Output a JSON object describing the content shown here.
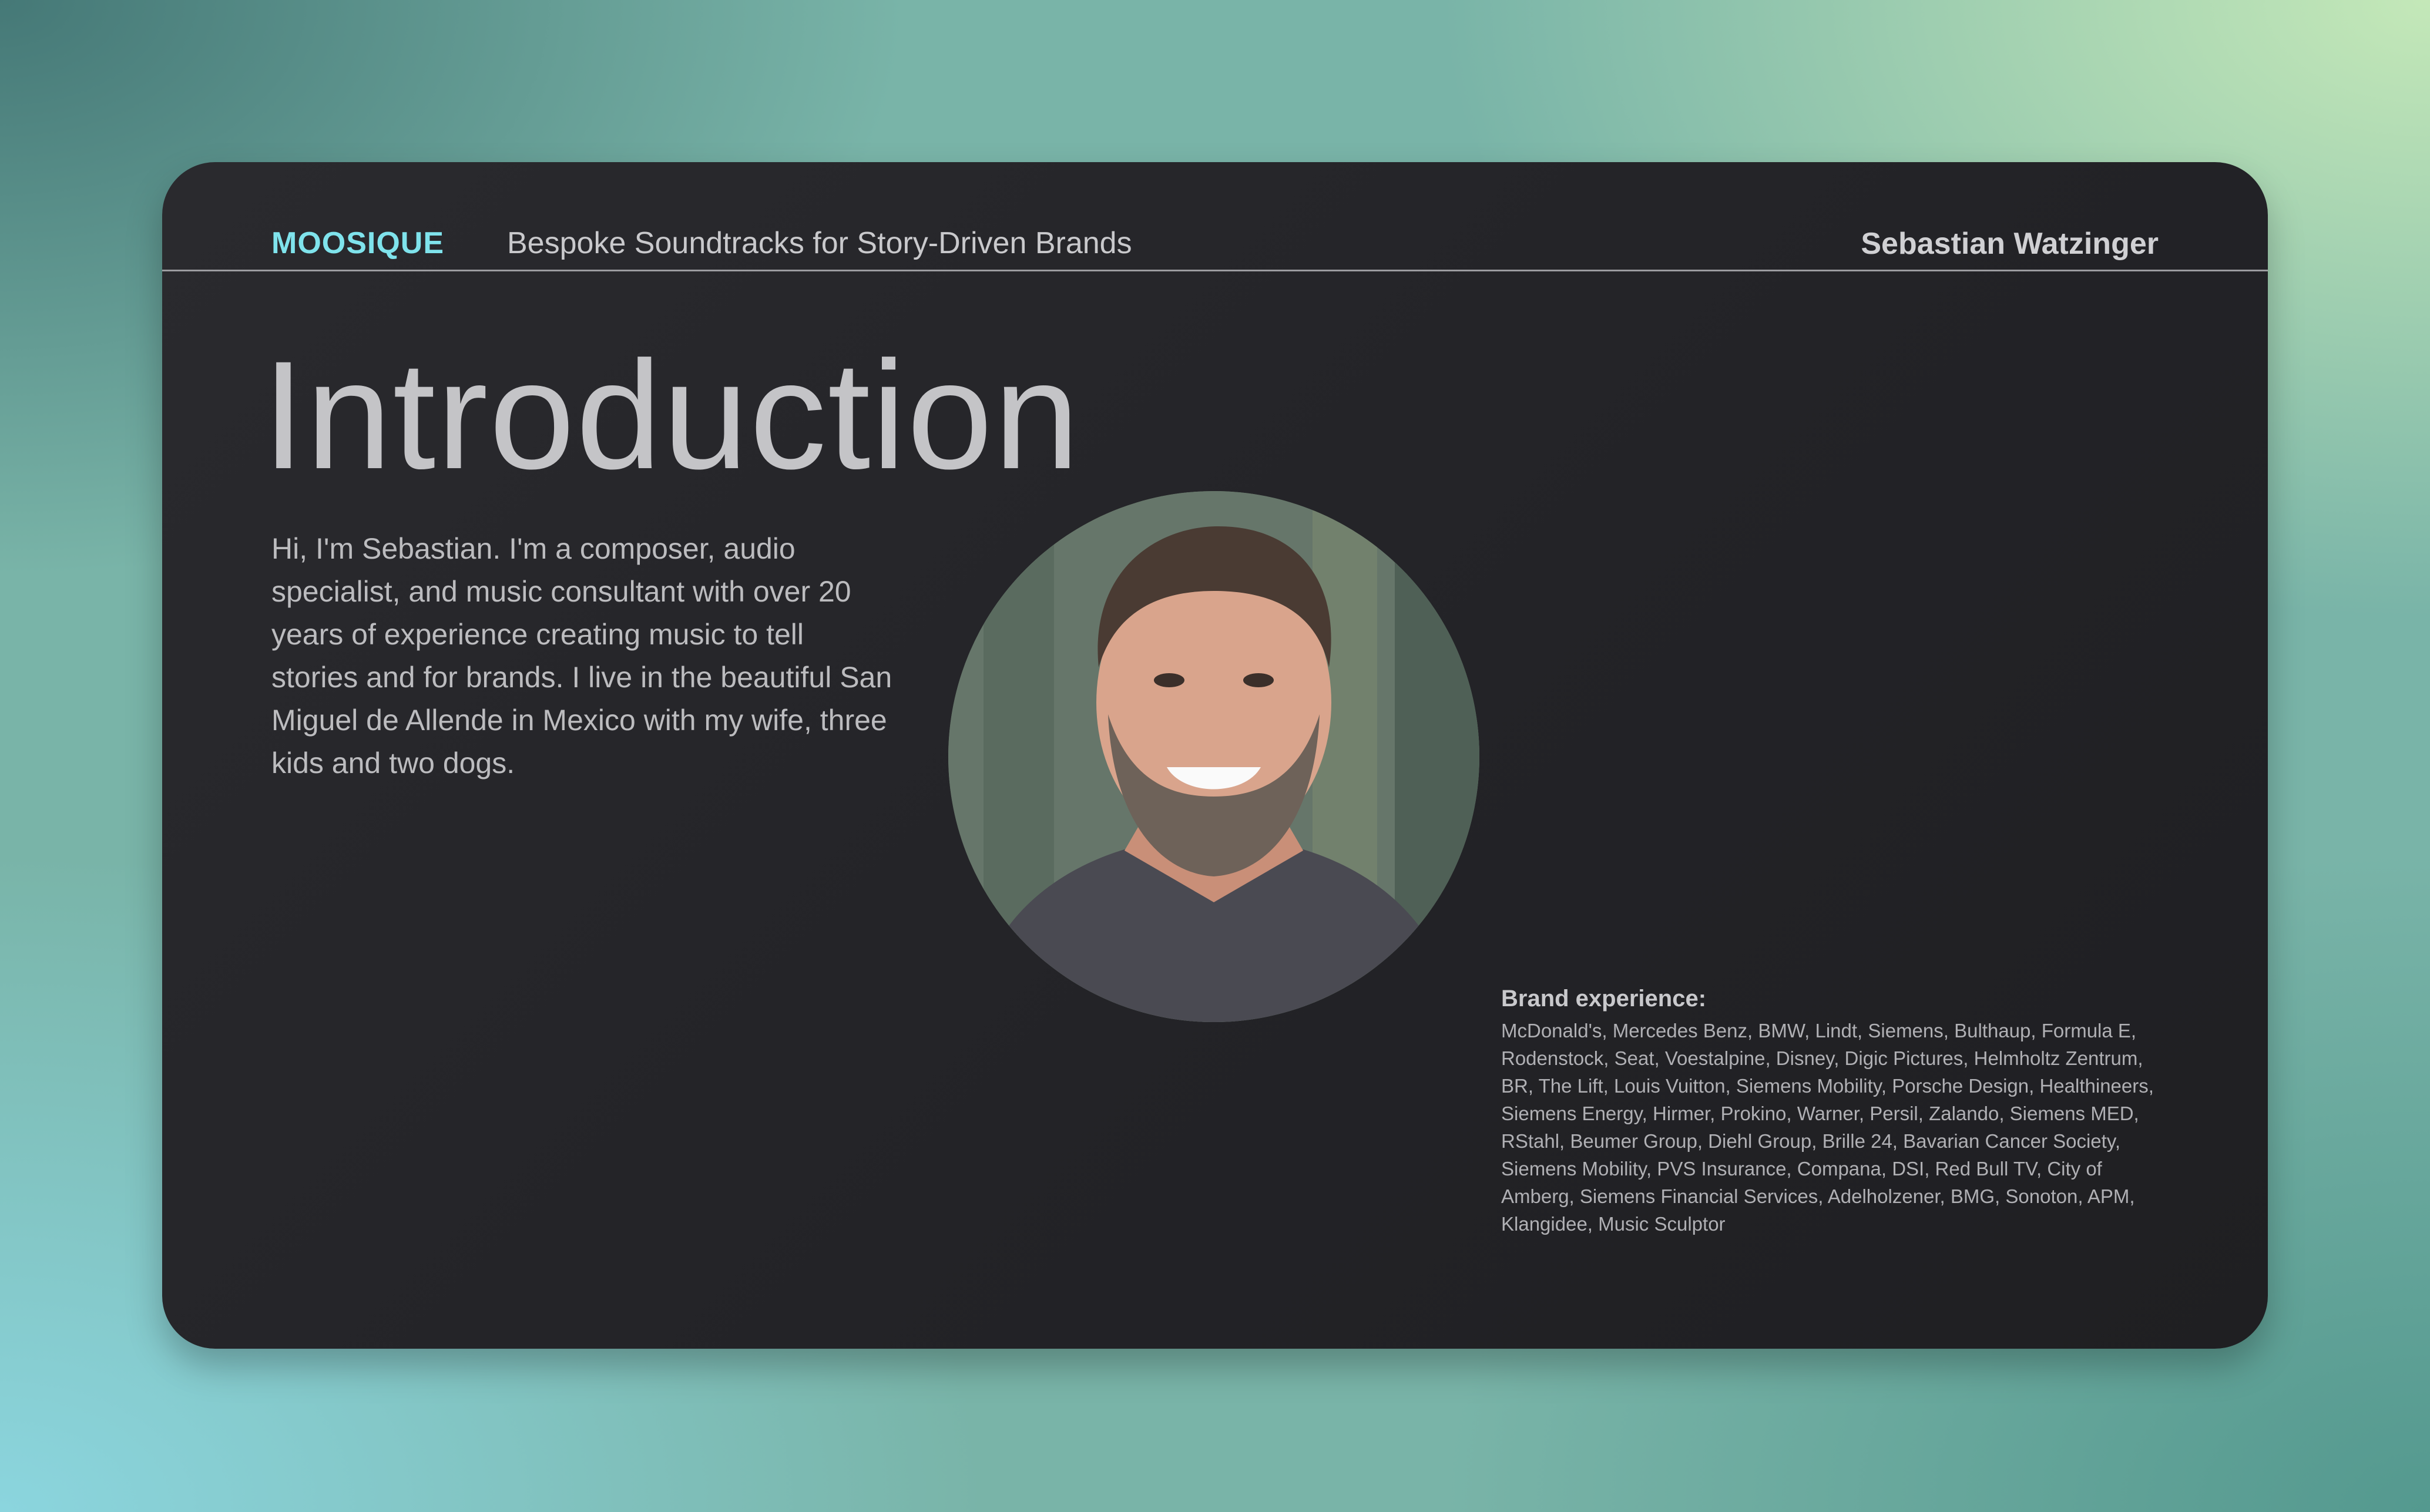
{
  "header": {
    "brand": "MOOSIQUE",
    "tagline": "Bespoke Soundtracks for Story-Driven Brands",
    "author": "Sebastian Watzinger"
  },
  "main": {
    "title": "Introduction",
    "intro": "Hi, I'm Sebastian. I'm a composer, audio specialist, and music consultant with over 20 years of experience creating music to tell stories and for brands. I live in the beautiful San Miguel de Allende in Mexico with my wife, three kids and two dogs.",
    "brands_heading": "Brand experience:",
    "brands_list": "McDonald's, Mercedes Benz, BMW, Lindt, Siemens, Bulthaup, Formula E, Rodenstock, Seat, Voestalpine, Disney, Digic Pictures, Helmholtz Zentrum, BR, The Lift, Louis Vuitton, Siemens Mobility, Porsche Design, Healthineers, Siemens Energy, Hirmer, Prokino, Warner, Persil, Zalando, Siemens MED, RStahl, Beumer Group, Diehl Group, Brille 24, Bavarian Cancer Society, Siemens Mobility, PVS Insurance, Compana, DSI, Red Bull TV, City of Amberg, Siemens Financial Services, Adelholzener, BMG, Sonoton, APM, Klangidee, Music Sculptor"
  },
  "colors": {
    "accent": "#7fe3ec",
    "slide_background": "#232327",
    "text": "#c4c4c7"
  }
}
